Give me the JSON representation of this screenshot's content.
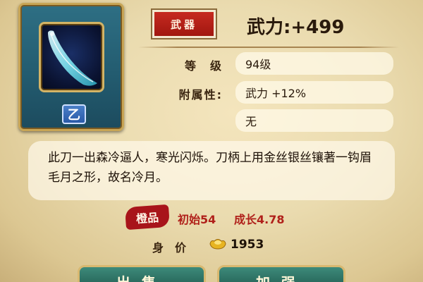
{
  "item": {
    "type_label": "武器",
    "power_text": "武力:+499",
    "grade": "乙"
  },
  "stats": {
    "level_label": "等　级",
    "level_value": "94级",
    "attr_label": "附属性:",
    "attr_value": "武力 +12%",
    "attr2_value": "无"
  },
  "description": "此刀一出森冷逼人，寒光闪烁。刀柄上用金丝银丝镶著一钩眉毛月之形，故名冷月。",
  "quality": {
    "badge": "橙品",
    "initial": "初始54",
    "growth": "成长4.78"
  },
  "price": {
    "label": "身价",
    "value": "1953"
  },
  "buttons": {
    "sell": "出售",
    "upgrade": "加强"
  },
  "colors": {
    "accent_red": "#b0201a",
    "frame_teal": "#2e6f84",
    "button_green": "#2f7566",
    "gold_trim": "#c8a555"
  }
}
